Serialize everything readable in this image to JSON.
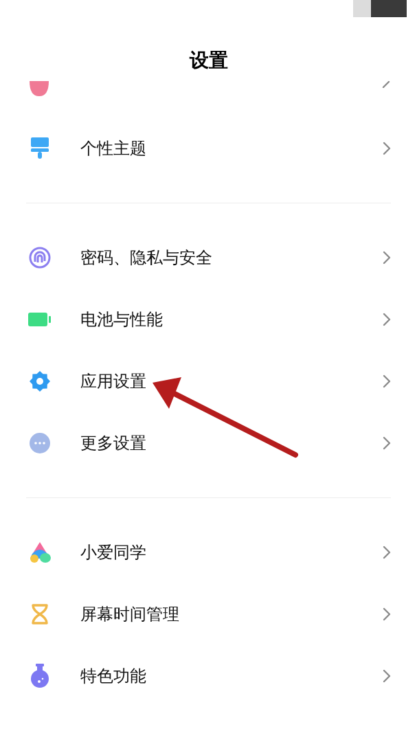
{
  "title": "设置",
  "sections": [
    {
      "items": [
        {
          "kind": "theme",
          "label": "个性主题"
        }
      ]
    },
    {
      "items": [
        {
          "kind": "fingerprint",
          "label": "密码、隐私与安全"
        },
        {
          "kind": "battery",
          "label": "电池与性能"
        },
        {
          "kind": "gear",
          "label": "应用设置"
        },
        {
          "kind": "more",
          "label": "更多设置"
        }
      ]
    },
    {
      "items": [
        {
          "kind": "assistant",
          "label": "小爱同学"
        },
        {
          "kind": "hourglass",
          "label": "屏幕时间管理"
        },
        {
          "kind": "flask",
          "label": "特色功能"
        }
      ]
    }
  ]
}
